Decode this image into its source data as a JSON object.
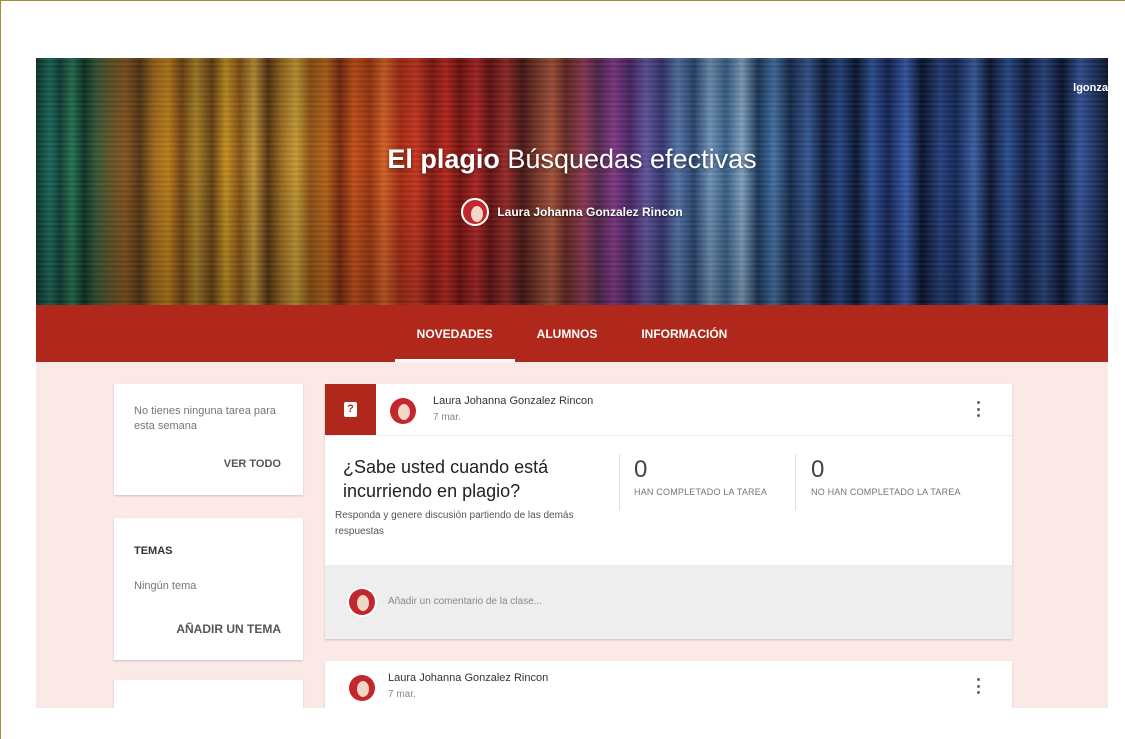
{
  "banner": {
    "user_label": "lgonza",
    "title_bold": "El plagio",
    "title_rest": "Búsquedas efectivas",
    "teacher_name": "Laura Johanna Gonzalez Rincon"
  },
  "tabs": [
    {
      "label": "NOVEDADES",
      "active": true
    },
    {
      "label": "ALUMNOS",
      "active": false
    },
    {
      "label": "INFORMACIÓN",
      "active": false
    }
  ],
  "tasks_card": {
    "message": "No tienes ninguna tarea para esta semana",
    "link": "VER TODO"
  },
  "topics_card": {
    "heading": "TEMAS",
    "empty": "Ningún tema",
    "link": "AÑADIR UN TEMA"
  },
  "post": {
    "badge_icon": "question-icon",
    "author": "Laura Johanna Gonzalez Rincon",
    "date": "7 mar.",
    "title": "¿Sabe usted cuando está incurriendo en plagio?",
    "description": "Responda y genere discusión partiendo de las demás respuestas",
    "completed_count": "0",
    "completed_label": "HAN COMPLETADO LA TAREA",
    "not_completed_count": "0",
    "not_completed_label": "NO HAN COMPLETADO LA TAREA",
    "comment_placeholder": "Añadir un comentario de la clase..."
  },
  "post2": {
    "author": "Laura Johanna Gonzalez Rincon",
    "date": "7 mar."
  },
  "colors": {
    "accent": "#b0271b",
    "page_bg": "#fbe9e7"
  }
}
